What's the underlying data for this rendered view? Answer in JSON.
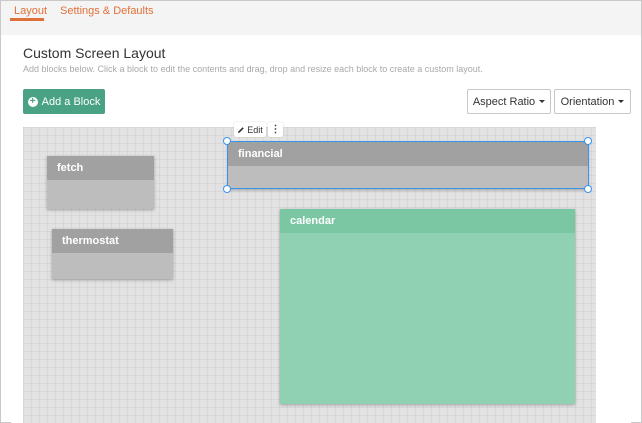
{
  "tabs": [
    {
      "label": "Layout",
      "active": true
    },
    {
      "label": "Settings & Defaults",
      "active": false
    }
  ],
  "header": {
    "title": "Custom Screen Layout",
    "subtitle": "Add blocks below. Click a block to edit the contents and drag, drop and resize each block to create a custom layout."
  },
  "toolbar": {
    "add_block_label": "Add a Block",
    "aspect_ratio_label": "Aspect Ratio",
    "orientation_label": "Orientation"
  },
  "block_toolbar": {
    "edit_label": "Edit",
    "more_label": "⋮",
    "edit_icon": "pencil-icon"
  },
  "blocks": [
    {
      "name": "fetch"
    },
    {
      "name": "thermostat"
    },
    {
      "name": "financial",
      "selected": true
    },
    {
      "name": "calendar"
    }
  ],
  "colors": {
    "accent": "#e0703a",
    "primary_button": "#4aa284",
    "selection": "#3a93ea",
    "block_gray": "#bdbdbd",
    "block_green": "#8fd1b2"
  }
}
